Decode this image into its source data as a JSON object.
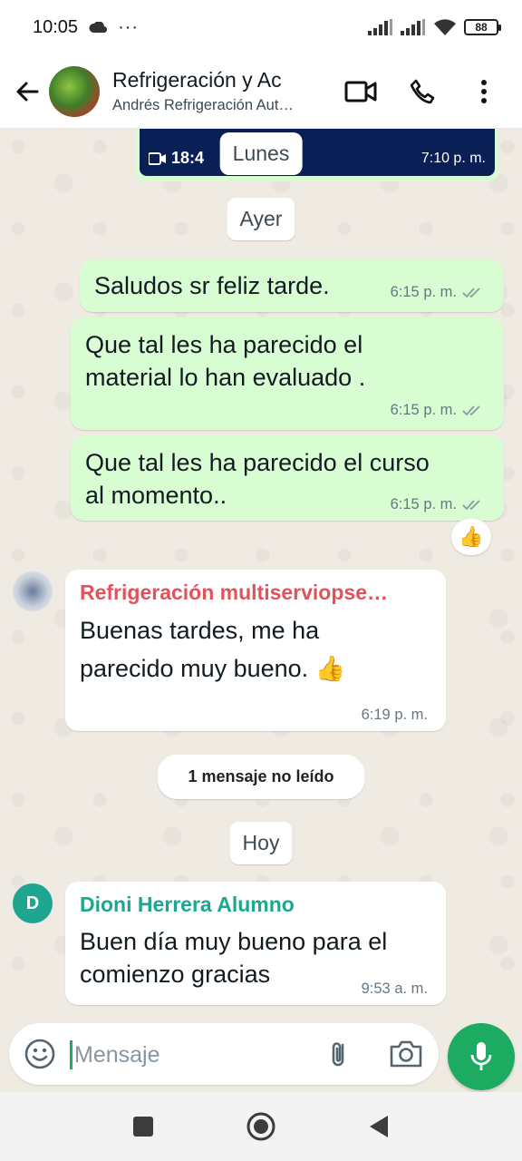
{
  "status_bar": {
    "time": "10:05",
    "more": "···",
    "battery": "88"
  },
  "header": {
    "title": "Refrigeración y Ac",
    "subtitle": "Andrés Refrigeración Aut…",
    "icons": [
      "back-arrow-icon",
      "video-call-icon",
      "phone-icon",
      "more-vert-icon"
    ]
  },
  "chat": {
    "media_preview": {
      "duration": "18:4",
      "time": "7:10 p. m."
    },
    "date_chips": [
      "Lunes",
      "Ayer",
      "Hoy"
    ],
    "unread_chip": "1 mensaje no leído",
    "messages": [
      {
        "direction": "out",
        "text": "Saludos sr feliz tarde.",
        "time": "6:15 p. m."
      },
      {
        "direction": "out",
        "text": "Que tal les ha parecido el material lo  han evaluado .",
        "time": "6:15 p. m."
      },
      {
        "direction": "out",
        "text": "Que tal les ha parecido el curso al momento..",
        "time": "6:15 p. m.",
        "reaction": "👍"
      },
      {
        "direction": "in",
        "sender": "Refrigeración multiserviopse…",
        "sender_color": "#e0535b",
        "text": "Buenas tardes, me ha parecido muy bueno. 👍",
        "time": "6:19 p. m."
      },
      {
        "direction": "in",
        "sender": "Dioni Herrera Alumno",
        "sender_color": "#1ea690",
        "avatar_letter": "D",
        "text": "Buen día muy bueno para el comienzo gracias",
        "time": "9:53 a. m."
      }
    ]
  },
  "composer": {
    "placeholder": "Mensaje"
  },
  "colors": {
    "accent": "#1daa61",
    "outgoing_bubble": "#d9fdd3",
    "read_ticks": "#8c9ba3"
  }
}
